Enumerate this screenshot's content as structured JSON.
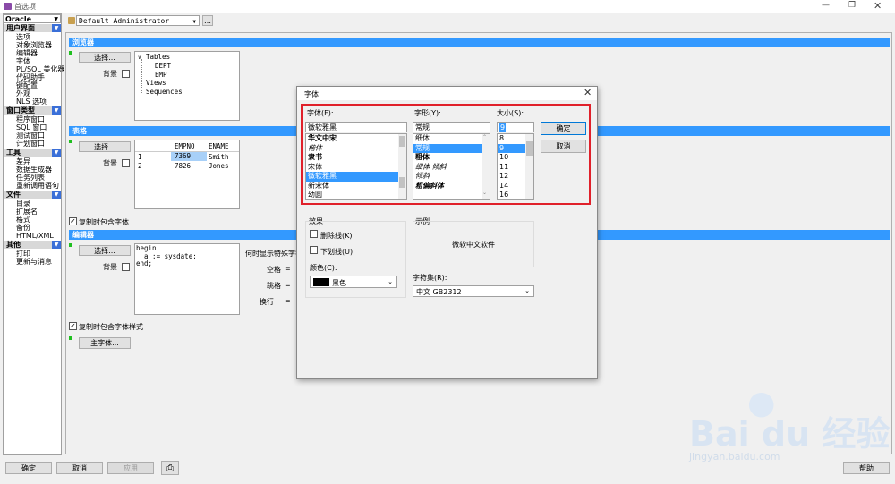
{
  "window": {
    "title": "首选项"
  },
  "sidebar": {
    "combo": "Oracle",
    "categories": [
      {
        "label": "用户界面",
        "items": [
          "选项",
          "对象浏览器",
          "编辑器",
          "字体",
          "PL/SQL 美化器",
          "代码助手",
          "键配置",
          "外观",
          "NLS 选项"
        ]
      },
      {
        "label": "窗口类型",
        "items": [
          "程序窗口",
          "SQL 窗口",
          "测试窗口",
          "计划窗口"
        ]
      },
      {
        "label": "工具",
        "items": [
          "差异",
          "数据生成器",
          "任务列表",
          "重新调用语句"
        ]
      },
      {
        "label": "文件",
        "items": [
          "目录",
          "扩展名",
          "格式",
          "备份",
          "HTML/XML"
        ]
      },
      {
        "label": "其他",
        "items": [
          "打印",
          "更新与消息"
        ]
      }
    ]
  },
  "top": {
    "profile": "Default Administrator",
    "more": "…"
  },
  "browser": {
    "header": "浏览器",
    "select": "选择...",
    "bg": "背景",
    "tree": [
      "Tables",
      "DEPT",
      "EMP",
      "Views",
      "Sequences"
    ]
  },
  "grid": {
    "header": "表格",
    "select": "选择...",
    "bg": "背景",
    "columns": [
      "EMPNO",
      "ENAME"
    ],
    "rows": [
      [
        "1",
        "7369",
        "Smith"
      ],
      [
        "2",
        "7826",
        "Jones"
      ]
    ],
    "copy": "复制时包含字体"
  },
  "editor": {
    "header": "编辑器",
    "select": "选择...",
    "bg": "背景",
    "code": [
      "begin",
      "  a := sysdate;",
      "end;"
    ],
    "special": "何时显示特殊字符",
    "space": "空格",
    "tab": "跳格",
    "newline": "换行",
    "eq": "=",
    "copy": "复制时包含字体样式",
    "main_font": "主字体..."
  },
  "bottom": {
    "ok": "确定",
    "cancel": "取消",
    "apply": "应用",
    "help": "帮助"
  },
  "dialog": {
    "title": "字体",
    "font_label": "字体(F):",
    "font_value": "微软雅黑",
    "fonts": [
      "华文中宋",
      "楷体",
      "隶书",
      "宋体",
      "微软雅黑",
      "新宋体",
      "幼圆"
    ],
    "style_label": "字形(Y):",
    "style_value": "常规",
    "styles": [
      "细体",
      "常规",
      "粗体",
      "细体 倾斜",
      "倾斜",
      "粗偏斜体"
    ],
    "size_label": "大小(S):",
    "size_value": "9",
    "sizes": [
      "8",
      "9",
      "10",
      "11",
      "12",
      "14",
      "16"
    ],
    "ok": "确定",
    "cancel": "取消",
    "effects": "效果",
    "strike": "删除线(K)",
    "underline": "下划线(U)",
    "color_label": "颜色(C):",
    "color_value": "黑色",
    "sample": "示例",
    "sample_text": "微软中文软件",
    "charset_label": "字符集(R):",
    "charset_value": "中文 GB2312"
  },
  "watermark": {
    "brand": "Bai du 经验",
    "url": "jingyan.baidu.com"
  },
  "colors": {
    "accent": "#3399ff",
    "highlight_box": "#e0202a"
  }
}
